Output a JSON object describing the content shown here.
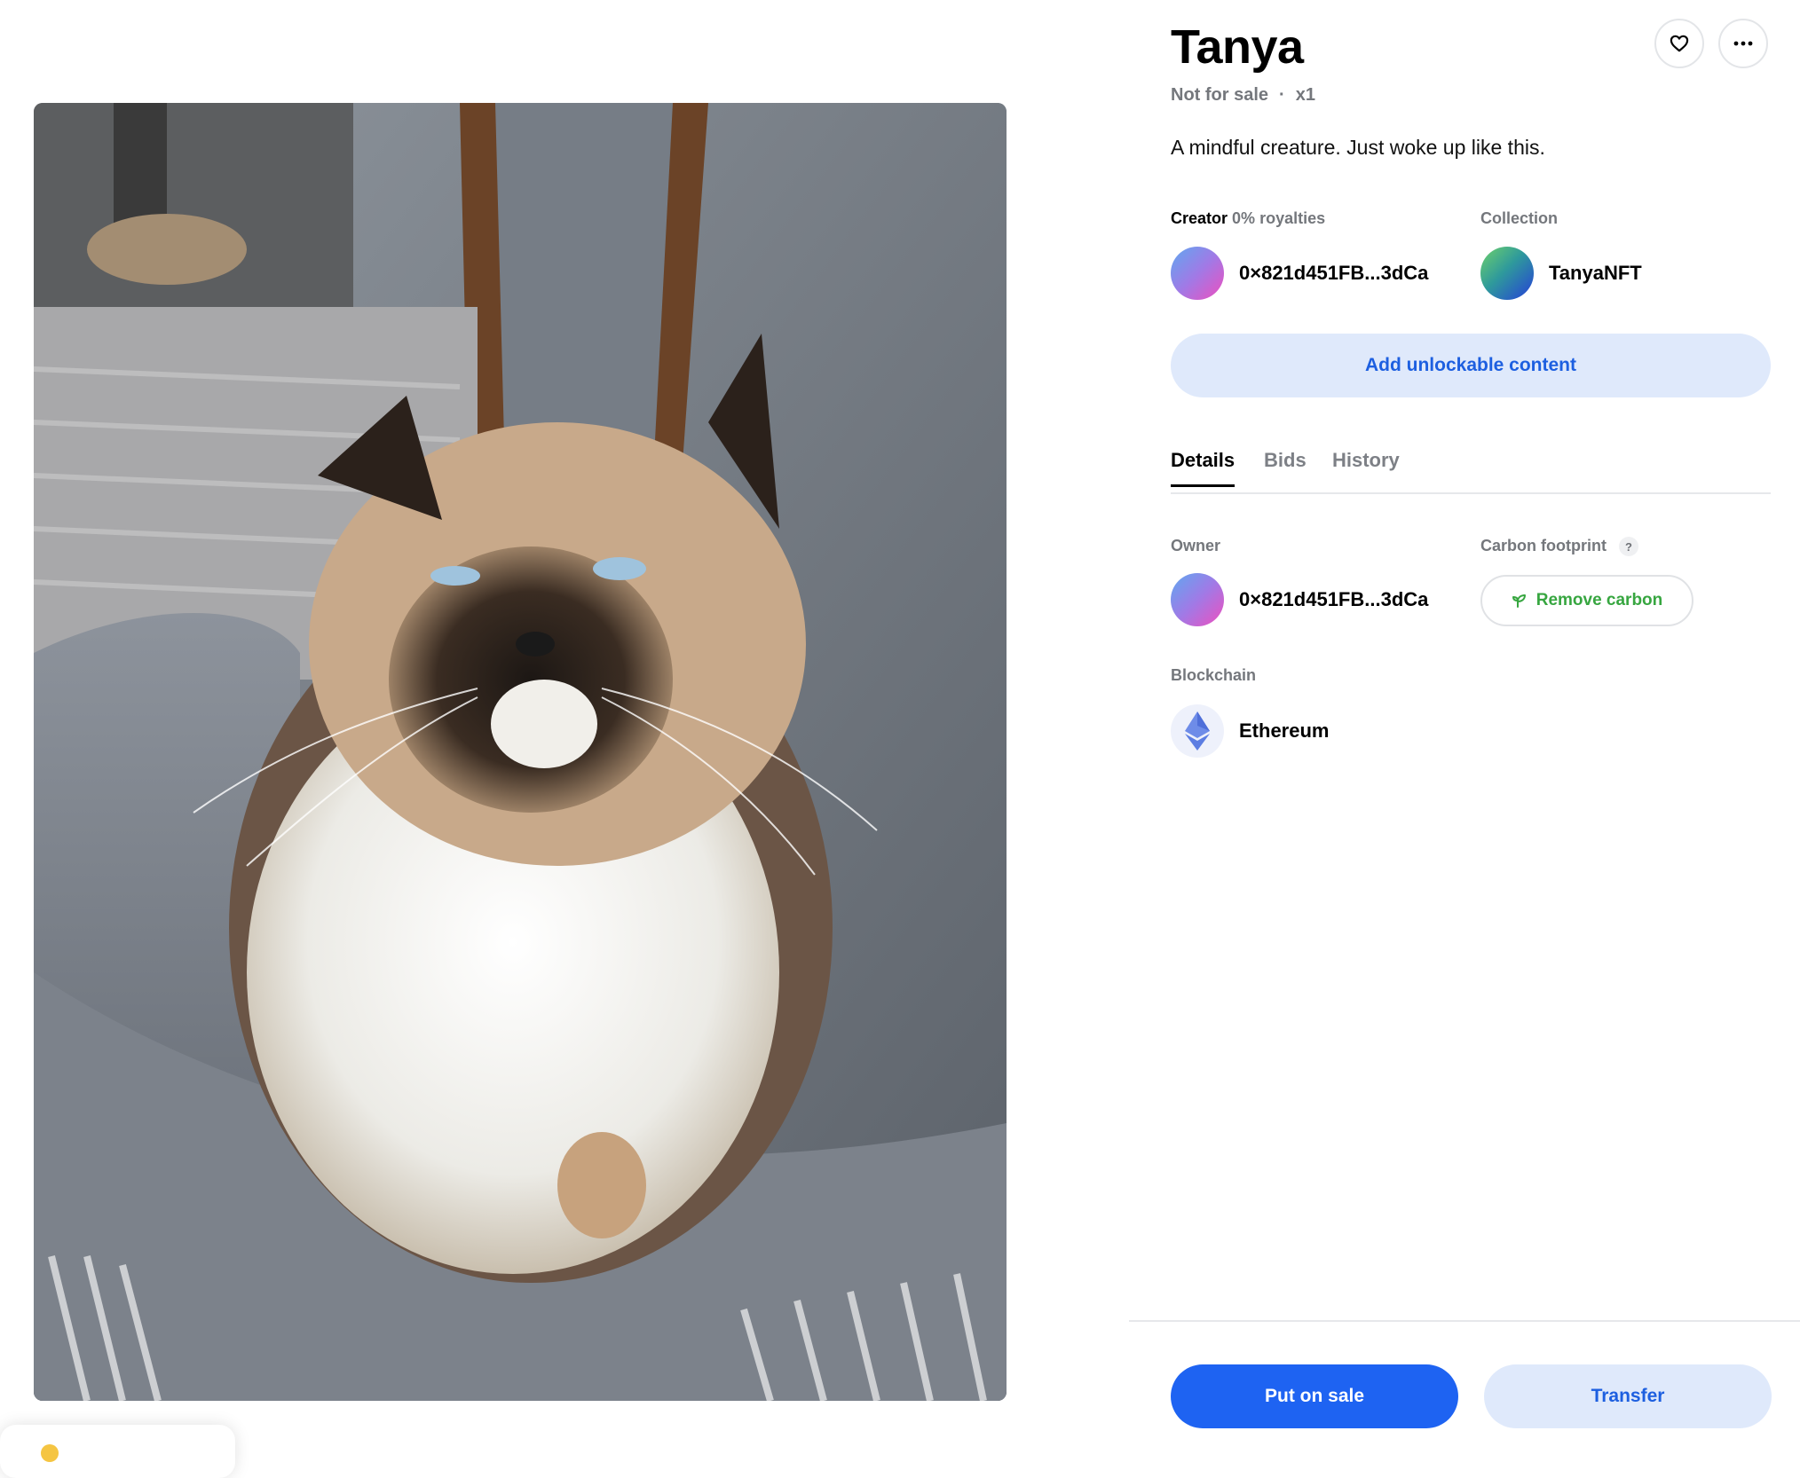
{
  "item": {
    "title": "Tanya",
    "sale_status": "Not for sale",
    "separator": "·",
    "edition": "x1",
    "description": "A mindful creature. Just woke up like this."
  },
  "icons": {
    "like": "heart-icon",
    "more": "more-dots-icon",
    "carbon": "sprout-icon",
    "chain": "ethereum-icon"
  },
  "creator": {
    "label": "Creator",
    "royalties": "0% royalties",
    "address": "0×821d451FB...3dCa"
  },
  "collection": {
    "label": "Collection",
    "name": "TanyaNFT"
  },
  "actions": {
    "unlockable": "Add unlockable content",
    "put_on_sale": "Put on sale",
    "transfer": "Transfer"
  },
  "tabs": [
    {
      "label": "Details",
      "active": true
    },
    {
      "label": "Bids",
      "active": false
    },
    {
      "label": "History",
      "active": false
    }
  ],
  "details": {
    "owner_label": "Owner",
    "owner_address": "0×821d451FB...3dCa",
    "carbon_label": "Carbon footprint",
    "carbon_help": "?",
    "carbon_action": "Remove carbon",
    "blockchain_label": "Blockchain",
    "blockchain_name": "Ethereum"
  },
  "colors": {
    "primary": "#1e63f2",
    "primary_soft": "#dfe9fb",
    "muted_text": "#74777c",
    "carbon_green": "#37a640"
  }
}
